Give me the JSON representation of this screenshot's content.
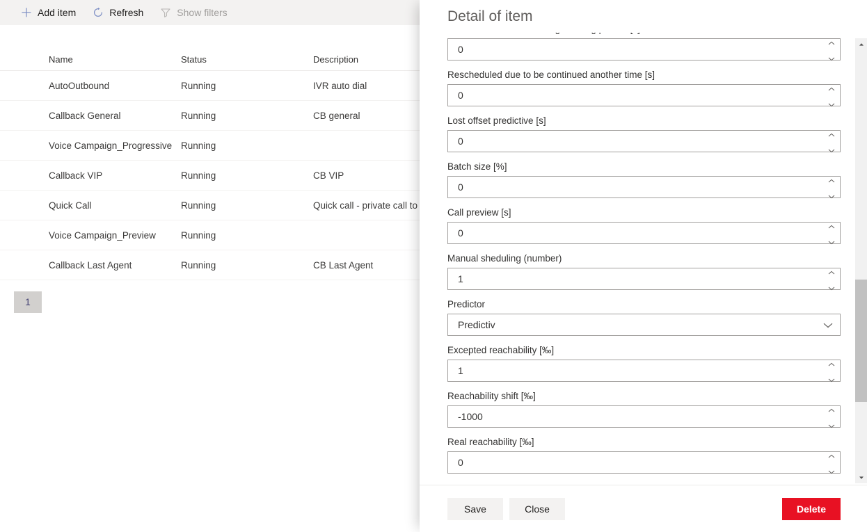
{
  "toolbar": {
    "add_item_label": "Add item",
    "refresh_label": "Refresh",
    "show_filters_label": "Show filters"
  },
  "list": {
    "columns": [
      {
        "key": "name",
        "label": "Name"
      },
      {
        "key": "status",
        "label": "Status"
      },
      {
        "key": "description",
        "label": "Description"
      }
    ],
    "rows": [
      {
        "name": "AutoOutbound",
        "status": "Running",
        "description": "IVR auto dial"
      },
      {
        "name": "Callback General",
        "status": "Running",
        "description": "CB general"
      },
      {
        "name": "Voice Campaign_Progressive",
        "status": "Running",
        "description": ""
      },
      {
        "name": "Callback VIP",
        "status": "Running",
        "description": "CB VIP"
      },
      {
        "name": "Quick Call",
        "status": "Running",
        "description": "Quick call - private call to be"
      },
      {
        "name": "Voice Campaign_Preview",
        "status": "Running",
        "description": ""
      },
      {
        "name": "Callback Last Agent",
        "status": "Running",
        "description": "CB Last Agent"
      }
    ],
    "pagination": {
      "current_page": "1"
    }
  },
  "panel": {
    "title": "Detail of item",
    "fields": [
      {
        "label": "Rescheduled due to calling a wrong person [s]",
        "value": "0",
        "type": "number",
        "clipped": true
      },
      {
        "label": "Rescheduled due to be continued another time [s]",
        "value": "0",
        "type": "number"
      },
      {
        "label": "Lost offset predictive [s]",
        "value": "0",
        "type": "number"
      },
      {
        "label": "Batch size [%]",
        "value": "0",
        "type": "number"
      },
      {
        "label": "Call preview [s]",
        "value": "0",
        "type": "number"
      },
      {
        "label": "Manual sheduling (number)",
        "value": "1",
        "type": "number"
      },
      {
        "label": "Predictor",
        "value": "Predictiv",
        "type": "select"
      },
      {
        "label": "Excepted reachability [‰]",
        "value": "1",
        "type": "number"
      },
      {
        "label": "Reachability shift [‰]",
        "value": "-1000",
        "type": "number"
      },
      {
        "label": "Real reachability [‰]",
        "value": "0",
        "type": "number"
      }
    ],
    "footer": {
      "save_label": "Save",
      "close_label": "Close",
      "delete_label": "Delete"
    }
  },
  "colors": {
    "danger": "#e81123",
    "command_icon": "#7c8ec4",
    "toolbar_bg": "#f3f2f1",
    "disabled_text": "#a19f9d"
  }
}
